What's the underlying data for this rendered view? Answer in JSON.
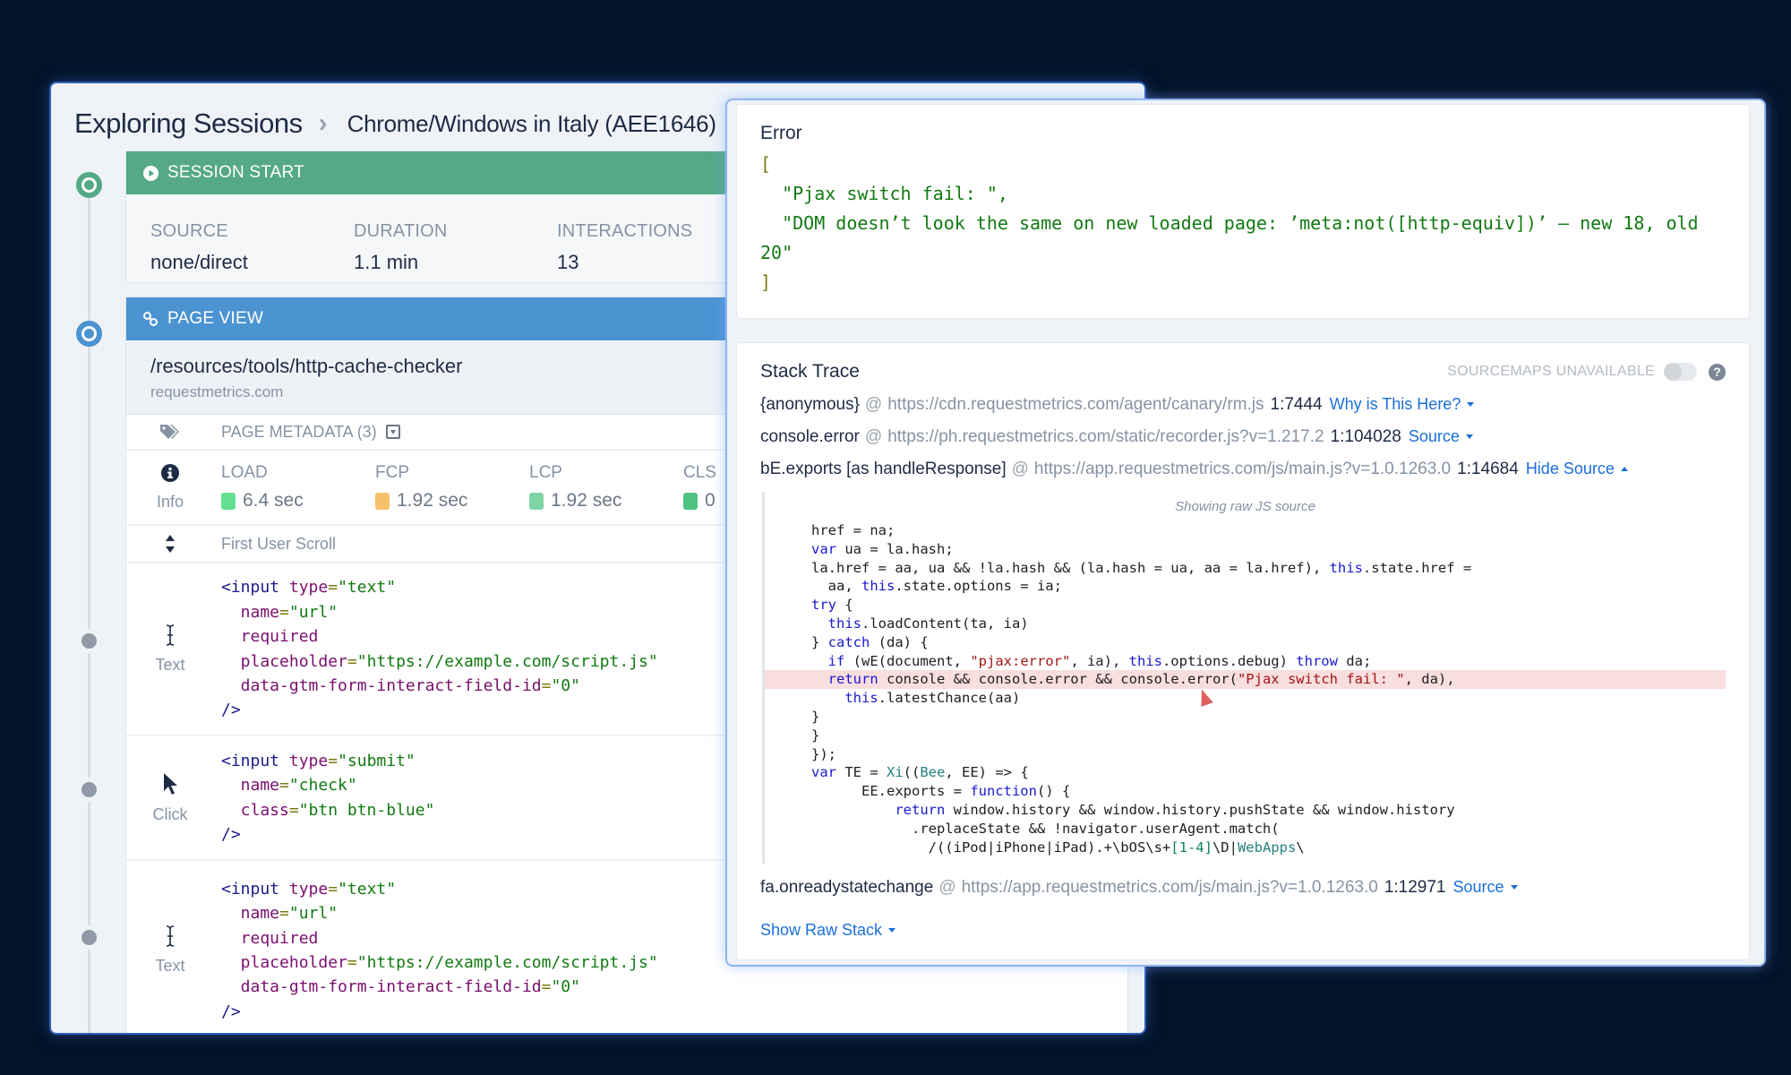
{
  "breadcrumb": {
    "root": "Exploring Sessions",
    "separator": "›",
    "current": "Chrome/Windows in Italy (AEE1646)"
  },
  "session_start": {
    "header": "SESSION START",
    "stats": [
      {
        "label": "SOURCE",
        "value": "none/direct"
      },
      {
        "label": "DURATION",
        "value": "1.1 min"
      },
      {
        "label": "INTERACTIONS",
        "value": "13"
      }
    ]
  },
  "page_view": {
    "header": "PAGE VIEW",
    "path": "/resources/tools/http-cache-checker",
    "host": "requestmetrics.com",
    "metadata_label": "PAGE METADATA (3)",
    "info_label": "Info",
    "metrics": [
      {
        "label": "LOAD",
        "value": "6.4 sec",
        "color": "#63e08f"
      },
      {
        "label": "FCP",
        "value": "1.92 sec",
        "color": "#f8c06a"
      },
      {
        "label": "LCP",
        "value": "1.92 sec",
        "color": "#7fd4a4"
      },
      {
        "label": "CLS",
        "value": "0",
        "color": "#4fc482"
      }
    ],
    "scroll_label": "First User Scroll"
  },
  "events": [
    {
      "kind": "Text",
      "lines": [
        [
          {
            "t": "tag",
            "v": "<input "
          },
          {
            "t": "attr",
            "v": "type"
          },
          {
            "t": "eq",
            "v": "="
          },
          {
            "t": "str",
            "v": "\"text\""
          }
        ],
        [
          {
            "t": "attr",
            "v": "  name"
          },
          {
            "t": "eq",
            "v": "="
          },
          {
            "t": "str",
            "v": "\"url\""
          }
        ],
        [
          {
            "t": "attr",
            "v": "  required"
          }
        ],
        [
          {
            "t": "attr",
            "v": "  placeholder"
          },
          {
            "t": "eq",
            "v": "="
          },
          {
            "t": "str",
            "v": "\"https://example.com/script.js\""
          }
        ],
        [
          {
            "t": "attr",
            "v": "  data-gtm-form-interact-field-id"
          },
          {
            "t": "eq",
            "v": "="
          },
          {
            "t": "str",
            "v": "\"0\""
          }
        ],
        [
          {
            "t": "tag",
            "v": "/>"
          }
        ]
      ]
    },
    {
      "kind": "Click",
      "lines": [
        [
          {
            "t": "tag",
            "v": "<input "
          },
          {
            "t": "attr",
            "v": "type"
          },
          {
            "t": "eq",
            "v": "="
          },
          {
            "t": "str",
            "v": "\"submit\""
          }
        ],
        [
          {
            "t": "attr",
            "v": "  name"
          },
          {
            "t": "eq",
            "v": "="
          },
          {
            "t": "str",
            "v": "\"check\""
          }
        ],
        [
          {
            "t": "attr",
            "v": "  class"
          },
          {
            "t": "eq",
            "v": "="
          },
          {
            "t": "str",
            "v": "\"btn btn-blue\""
          }
        ],
        [
          {
            "t": "tag",
            "v": "/>"
          }
        ]
      ]
    },
    {
      "kind": "Text",
      "lines": [
        [
          {
            "t": "tag",
            "v": "<input "
          },
          {
            "t": "attr",
            "v": "type"
          },
          {
            "t": "eq",
            "v": "="
          },
          {
            "t": "str",
            "v": "\"text\""
          }
        ],
        [
          {
            "t": "attr",
            "v": "  name"
          },
          {
            "t": "eq",
            "v": "="
          },
          {
            "t": "str",
            "v": "\"url\""
          }
        ],
        [
          {
            "t": "attr",
            "v": "  required"
          }
        ],
        [
          {
            "t": "attr",
            "v": "  placeholder"
          },
          {
            "t": "eq",
            "v": "="
          },
          {
            "t": "str",
            "v": "\"https://example.com/script.js\""
          }
        ],
        [
          {
            "t": "attr",
            "v": "  data-gtm-form-interact-field-id"
          },
          {
            "t": "eq",
            "v": "="
          },
          {
            "t": "str",
            "v": "\"0\""
          }
        ],
        [
          {
            "t": "tag",
            "v": "/>"
          }
        ]
      ]
    }
  ],
  "error": {
    "title": "Error",
    "open_bracket": "[",
    "messages": [
      "  \"Pjax switch fail: \",",
      "  \"DOM doesn’t look the same on new loaded page: ’meta:not([http-equiv])’ – new 18, old 20\""
    ],
    "close_bracket": "]"
  },
  "stack": {
    "title": "Stack Trace",
    "sourcemaps_label": "SOURCEMAPS UNAVAILABLE",
    "sourcemaps_enabled": false,
    "help": "?",
    "frames": [
      {
        "fn": "{anonymous}",
        "url": "https://cdn.requestmetrics.com/agent/canary/rm.js",
        "pos": "1:7444",
        "link": "Why is This Here?",
        "expanded": false
      },
      {
        "fn": "console.error",
        "url": "https://ph.requestmetrics.com/static/recorder.js?v=1.217.2",
        "pos": "1:104028",
        "link": "Source",
        "expanded": false
      },
      {
        "fn": "bE.exports [as handleResponse]",
        "url": "https://app.requestmetrics.com/js/main.js?v=1.0.1263.0",
        "pos": "1:14684",
        "link": "Hide Source",
        "expanded": true
      },
      {
        "fn": "fa.onreadystatechange",
        "url": "https://app.requestmetrics.com/js/main.js?v=1.0.1263.0",
        "pos": "1:12971",
        "link": "Source",
        "expanded": false
      }
    ],
    "at": "@",
    "source_caption": "Showing raw JS source",
    "source_lines": [
      {
        "hl": false,
        "parts": [
          {
            "c": "",
            "v": "href = na;"
          }
        ]
      },
      {
        "hl": false,
        "parts": [
          {
            "c": "k",
            "v": "var"
          },
          {
            "c": "",
            "v": " ua = la.hash;"
          }
        ]
      },
      {
        "hl": false,
        "parts": [
          {
            "c": "",
            "v": "la.href = aa, ua && !la.hash && (la.hash = ua, aa = la.href), "
          },
          {
            "c": "k",
            "v": "this"
          },
          {
            "c": "",
            "v": ".state.href ="
          }
        ]
      },
      {
        "hl": false,
        "parts": [
          {
            "c": "",
            "v": "  aa, "
          },
          {
            "c": "k",
            "v": "this"
          },
          {
            "c": "",
            "v": ".state.options = ia;"
          }
        ]
      },
      {
        "hl": false,
        "parts": [
          {
            "c": "k",
            "v": "try"
          },
          {
            "c": "",
            "v": " {"
          }
        ]
      },
      {
        "hl": false,
        "parts": [
          {
            "c": "",
            "v": "  "
          },
          {
            "c": "k",
            "v": "this"
          },
          {
            "c": "",
            "v": ".loadContent(ta, ia)"
          }
        ]
      },
      {
        "hl": false,
        "parts": [
          {
            "c": "",
            "v": "} "
          },
          {
            "c": "k",
            "v": "catch"
          },
          {
            "c": "",
            "v": " (da) {"
          }
        ]
      },
      {
        "hl": false,
        "parts": [
          {
            "c": "",
            "v": "  "
          },
          {
            "c": "k",
            "v": "if"
          },
          {
            "c": "",
            "v": " (wE(document, "
          },
          {
            "c": "s",
            "v": "\"pjax:error\""
          },
          {
            "c": "",
            "v": ", ia), "
          },
          {
            "c": "k",
            "v": "this"
          },
          {
            "c": "",
            "v": ".options.debug) "
          },
          {
            "c": "k",
            "v": "throw"
          },
          {
            "c": "",
            "v": " da;"
          }
        ]
      },
      {
        "hl": true,
        "parts": [
          {
            "c": "",
            "v": "  "
          },
          {
            "c": "k",
            "v": "return"
          },
          {
            "c": "",
            "v": " console && console.error && console.error("
          },
          {
            "c": "s",
            "v": "\"Pjax switch fail: \""
          },
          {
            "c": "",
            "v": ", da),"
          }
        ]
      },
      {
        "hl": false,
        "parts": [
          {
            "c": "",
            "v": "    "
          },
          {
            "c": "k",
            "v": "this"
          },
          {
            "c": "",
            "v": ".latestChance(aa)"
          }
        ]
      },
      {
        "hl": false,
        "parts": [
          {
            "c": "",
            "v": "}"
          }
        ]
      },
      {
        "hl": false,
        "parts": [
          {
            "c": "",
            "v": "}"
          }
        ]
      },
      {
        "hl": false,
        "parts": [
          {
            "c": "",
            "v": "});"
          }
        ]
      },
      {
        "hl": false,
        "parts": [
          {
            "c": "k",
            "v": "var"
          },
          {
            "c": "",
            "v": " TE = "
          },
          {
            "c": "c",
            "v": "Xi"
          },
          {
            "c": "",
            "v": "(("
          },
          {
            "c": "c",
            "v": "Bee"
          },
          {
            "c": "",
            "v": ", EE) => {"
          }
        ]
      },
      {
        "hl": false,
        "parts": [
          {
            "c": "",
            "v": "      EE.exports = "
          },
          {
            "c": "k",
            "v": "function"
          },
          {
            "c": "",
            "v": "() {"
          }
        ]
      },
      {
        "hl": false,
        "parts": [
          {
            "c": "",
            "v": "          "
          },
          {
            "c": "k",
            "v": "return"
          },
          {
            "c": "",
            "v": " window.history && window.history.pushState && window.history"
          }
        ]
      },
      {
        "hl": false,
        "parts": [
          {
            "c": "",
            "v": "            .replaceState && !navigator.userAgent.match("
          }
        ]
      },
      {
        "hl": false,
        "parts": [
          {
            "c": "",
            "v": "              /((iPod|iPhone|iPad).+\\bOS\\s+"
          },
          {
            "c": "g",
            "v": "[1-4]"
          },
          {
            "c": "",
            "v": "\\D|"
          },
          {
            "c": "c",
            "v": "WebApps"
          },
          {
            "c": "",
            "v": "\\"
          }
        ]
      }
    ],
    "raw_stack_label": "Show Raw Stack"
  }
}
